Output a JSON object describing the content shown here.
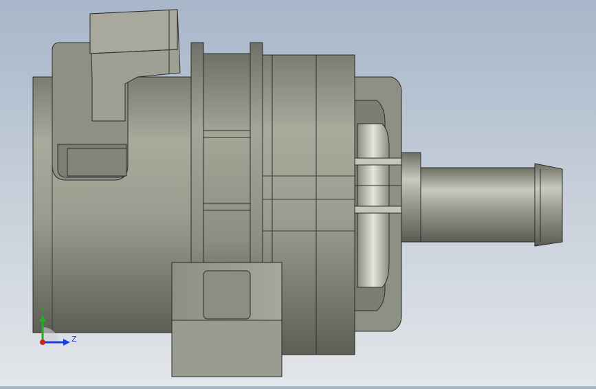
{
  "viewport": {
    "background_top": "#a7b6c9",
    "background_bottom": "#e3e6ea"
  },
  "triad": {
    "y_label": "Y",
    "z_label": "Z",
    "y_color": "#22b022",
    "z_color": "#1f3fe0",
    "x_color": "#d02020"
  },
  "model": {
    "body_color": "#9a9b8e",
    "edge_color": "#2b2b2b"
  }
}
